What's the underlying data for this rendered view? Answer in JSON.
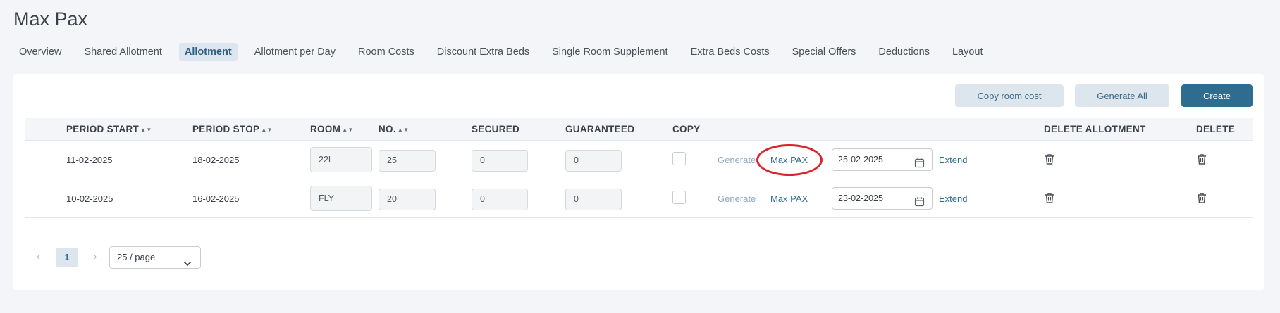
{
  "page": {
    "title": "Max Pax"
  },
  "tabs": [
    {
      "label": "Overview"
    },
    {
      "label": "Shared Allotment"
    },
    {
      "label": "Allotment",
      "active": true
    },
    {
      "label": "Allotment per Day"
    },
    {
      "label": "Room Costs"
    },
    {
      "label": "Discount Extra Beds"
    },
    {
      "label": "Single Room Supplement"
    },
    {
      "label": "Extra Beds Costs"
    },
    {
      "label": "Special Offers"
    },
    {
      "label": "Deductions"
    },
    {
      "label": "Layout"
    }
  ],
  "toolbar": {
    "copy_room_cost": "Copy room cost",
    "generate_all": "Generate All",
    "create": "Create"
  },
  "table": {
    "headers": {
      "period_start": "PERIOD START",
      "period_stop": "PERIOD STOP",
      "room": "ROOM",
      "no": "NO.",
      "secured": "SECURED",
      "guaranteed": "GUARANTEED",
      "copy": "COPY",
      "delete_allotment": "DELETE ALLOTMENT",
      "delete": "DELETE"
    },
    "rows": [
      {
        "period_start": "11-02-2025",
        "period_stop": "18-02-2025",
        "room": "22L",
        "no": "25",
        "secured": "0",
        "guaranteed": "0",
        "generate": "Generate",
        "max_pax": "Max PAX",
        "date": "25-02-2025",
        "extend": "Extend"
      },
      {
        "period_start": "10-02-2025",
        "period_stop": "16-02-2025",
        "room": "FLY",
        "no": "20",
        "secured": "0",
        "guaranteed": "0",
        "generate": "Generate",
        "max_pax": "Max PAX",
        "date": "23-02-2025",
        "extend": "Extend"
      }
    ]
  },
  "pagination": {
    "prev": "‹",
    "current_page": "1",
    "next": "›",
    "page_size": "25 / page"
  },
  "icons": {
    "sort": "sort-icon",
    "calendar": "calendar-icon",
    "trash": "trash-icon",
    "chevron": "chevron-down-icon"
  },
  "colors": {
    "accent": "#2f6d90",
    "highlight": "#d9232d"
  }
}
